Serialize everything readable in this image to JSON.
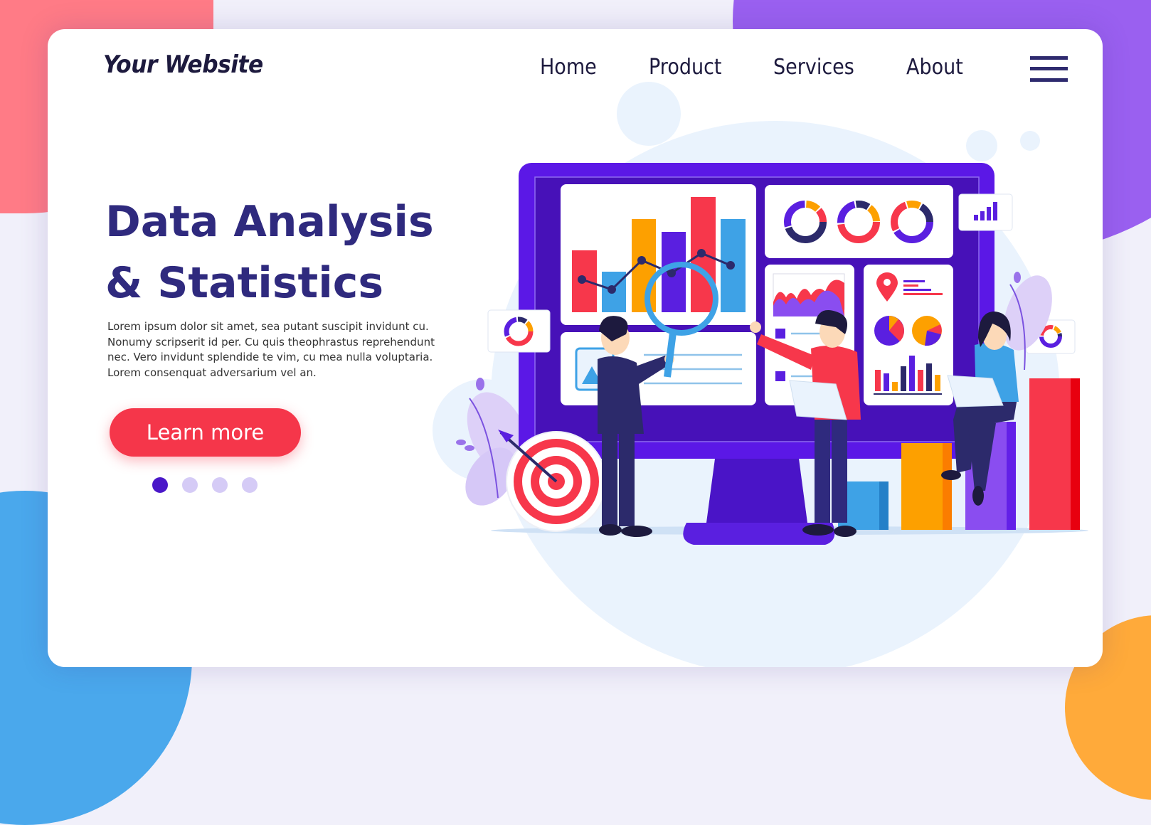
{
  "header": {
    "logo": "Your Website",
    "nav": [
      {
        "label": "Home"
      },
      {
        "label": "Product"
      },
      {
        "label": "Services"
      },
      {
        "label": "About"
      }
    ],
    "menu_icon": "hamburger-menu-icon"
  },
  "hero": {
    "title_line1": "Data Analysis",
    "title_line2": "& Statistics",
    "body": "Lorem ipsum dolor sit amet, sea putant suscipit invidunt cu. Nonumy scripserit id per. Cu quis theophrastus reprehendunt nec. Vero invidunt splendide te vim, cu mea nulla voluptaria. Lorem consenquat adversarium vel an.",
    "cta_label": "Learn more"
  },
  "carousel": {
    "total": 4,
    "active_index": 0
  },
  "illustration": {
    "description": "People analyzing charts on a large monitor",
    "icons": [
      "monitor-icon",
      "bar-chart-icon",
      "magnifier-icon",
      "donut-chart-icon",
      "area-chart-icon",
      "map-pin-icon",
      "pie-chart-icon",
      "target-icon",
      "signal-bars-icon"
    ]
  },
  "colors": {
    "title": "#2f2a7e",
    "cta": "#f5364a",
    "accent_purple": "#5a1fe0",
    "monitor": "#4b12c9",
    "red": "#f7374b",
    "blue": "#3ea2e6",
    "orange": "#fda000",
    "navy": "#2c2a6b",
    "bg_red_blob": "#ff7b86",
    "bg_purple_blob": "#9a60f0",
    "bg_blue_blob": "#4aa8ec",
    "bg_orange_blob": "#ffaa3a"
  }
}
